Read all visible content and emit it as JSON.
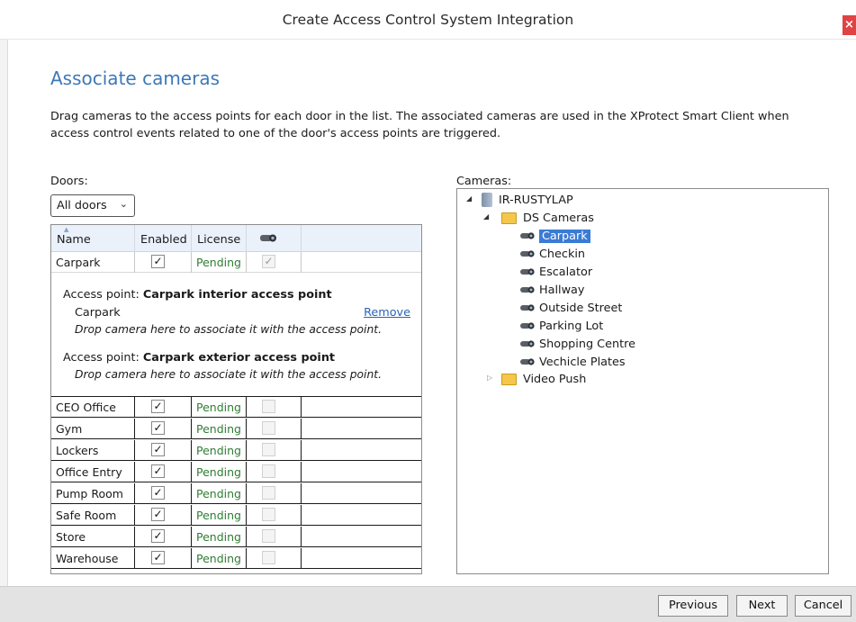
{
  "window": {
    "title": "Create Access Control System Integration",
    "close_glyph": "×"
  },
  "page": {
    "heading": "Associate cameras",
    "description": "Drag cameras to the access points for each door in the list. The associated cameras are used in the XProtect Smart Client when access control events related to one of the door's access points are triggered."
  },
  "doors": {
    "label": "Doors:",
    "filter": {
      "selected": "All doors"
    },
    "columns": {
      "name": "Name",
      "enabled": "Enabled",
      "license": "License",
      "camera_icon": "camera-icon"
    },
    "first_row": {
      "name": "Carpark",
      "enabled": true,
      "license": "Pending",
      "camera_checked": true
    },
    "access_points": [
      {
        "prefix": "Access point:",
        "name": "Carpark interior access point",
        "camera": "Carpark",
        "remove_label": "Remove",
        "drop_hint": "Drop camera here to associate it with the access point."
      },
      {
        "prefix": "Access point:",
        "name": "Carpark exterior access point",
        "camera": "",
        "remove_label": "",
        "drop_hint": "Drop camera here to associate it with the access point."
      }
    ],
    "rows": [
      {
        "name": "CEO Office",
        "enabled": true,
        "license": "Pending"
      },
      {
        "name": "Gym",
        "enabled": true,
        "license": "Pending"
      },
      {
        "name": "Lockers",
        "enabled": true,
        "license": "Pending"
      },
      {
        "name": "Office Entry",
        "enabled": true,
        "license": "Pending"
      },
      {
        "name": "Pump Room",
        "enabled": true,
        "license": "Pending"
      },
      {
        "name": "Safe Room",
        "enabled": true,
        "license": "Pending"
      },
      {
        "name": "Store",
        "enabled": true,
        "license": "Pending"
      },
      {
        "name": "Warehouse",
        "enabled": true,
        "license": "Pending"
      }
    ]
  },
  "cameras": {
    "label": "Cameras:",
    "tree": {
      "server": "IR-RUSTYLAP",
      "folders": [
        {
          "name": "DS Cameras",
          "expanded": true,
          "items": [
            "Carpark",
            "Checkin",
            "Escalator",
            "Hallway",
            "Outside Street",
            "Parking Lot",
            "Shopping Centre",
            "Vechicle Plates"
          ],
          "selected": "Carpark"
        },
        {
          "name": "Video Push",
          "expanded": false,
          "items": []
        }
      ]
    }
  },
  "footer": {
    "previous": "Previous",
    "next": "Next",
    "cancel": "Cancel"
  },
  "colors": {
    "heading": "#3d78b6",
    "license_pending": "#2e7d32",
    "selection": "#3a7bd5",
    "close": "#e04343"
  }
}
